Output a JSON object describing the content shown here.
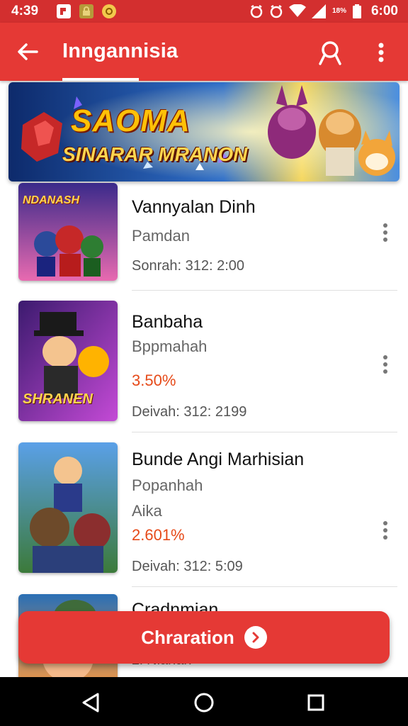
{
  "status_bar": {
    "time": "4:39",
    "battery_text": "18%",
    "clock": "6:00",
    "icons": [
      "notification-icon",
      "lock-icon",
      "coin-icon",
      "alarm-icon",
      "alarm-icon",
      "wifi-icon",
      "signal-icon",
      "battery-icon"
    ]
  },
  "app_bar": {
    "title": "Inngannisia",
    "accent": "#e53935"
  },
  "banner": {
    "title": "SAOMA",
    "subtitle": "SINARAR MRANON"
  },
  "items": [
    {
      "title": "Vannyalan Dinh",
      "line1": "Pamdan",
      "meta": "Sonrah: 312: 2:00",
      "thumb_text": "NDANASH"
    },
    {
      "title": "Banbaha",
      "line1": "Bppmahah",
      "percent": "3.50%",
      "meta": "Deivah: 312: 2199",
      "thumb_text": "SHRANEN"
    },
    {
      "title": "Bunde Angi Marhisian",
      "line1": "Popanhah",
      "line2": "Aika",
      "percent": "2.601%",
      "meta": "Deivah: 312: 5:09"
    },
    {
      "title": "Cradnmian",
      "meta": "2l Nianan"
    }
  ],
  "cta": {
    "label": "Chraration"
  },
  "nav": {
    "icons": [
      "back-triangle-icon",
      "home-circle-icon",
      "recents-square-icon"
    ]
  },
  "colors": {
    "primary": "#e53935",
    "status_bar": "#d32f2f",
    "percent_text": "#e64a19"
  }
}
